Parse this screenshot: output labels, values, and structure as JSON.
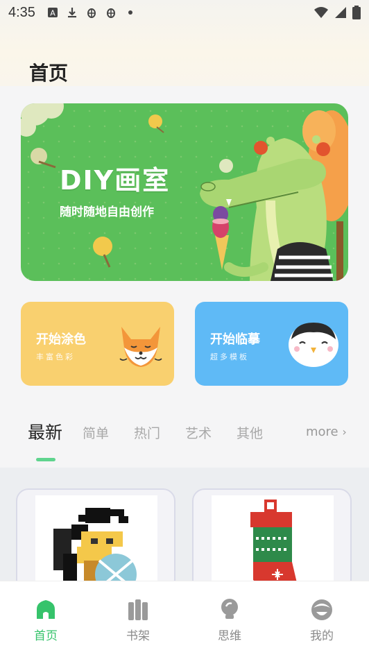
{
  "status_bar": {
    "time": "4:35",
    "icons_left": [
      "a-box-icon",
      "download-icon",
      "bug-icon",
      "bug-icon",
      "dot-icon"
    ],
    "icons_right": [
      "wifi-icon",
      "signal-icon",
      "battery-icon"
    ]
  },
  "header": {
    "title": "首页"
  },
  "hero": {
    "title": "DIY画室",
    "subtitle": "随时随地自由创作"
  },
  "cards": [
    {
      "title": "开始涂色",
      "subtitle": "丰富色彩",
      "icon": "fox-icon",
      "color": "#f9d06f"
    },
    {
      "title": "开始临摹",
      "subtitle": "超多模板",
      "icon": "penguin-icon",
      "color": "#5fbaf6"
    }
  ],
  "tabs": {
    "items": [
      "最新",
      "简单",
      "热门",
      "艺术",
      "其他"
    ],
    "active": "最新",
    "more_label": "more"
  },
  "thumbnails": [
    "viking-pixel-art",
    "christmas-stocking-pixel-art"
  ],
  "bottom_nav": [
    {
      "label": "首页",
      "icon": "home-icon",
      "active": true
    },
    {
      "label": "书架",
      "icon": "bookshelf-icon",
      "active": false
    },
    {
      "label": "思维",
      "icon": "bulb-icon",
      "active": false
    },
    {
      "label": "我的",
      "icon": "face-icon",
      "active": false
    }
  ],
  "colors": {
    "accent": "#36c36b",
    "indicator": "#5fd48e",
    "hero_bg": "#5bbf5a"
  }
}
